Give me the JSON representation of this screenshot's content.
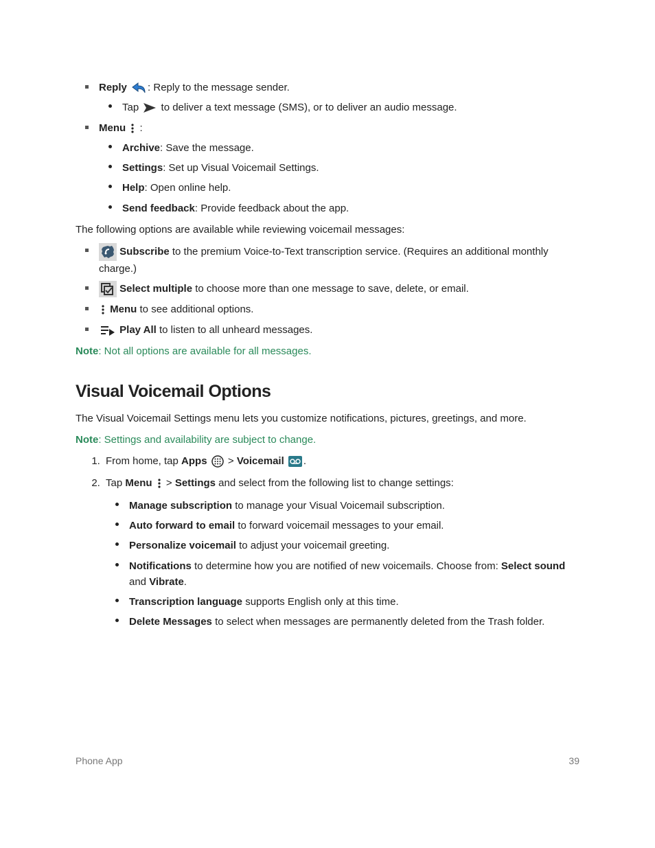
{
  "reply": {
    "label": "Reply",
    "desc": ": Reply to the message sender.",
    "tap": "Tap ",
    "tap_rest": " to deliver a text message (SMS), or to deliver an audio message."
  },
  "menu": {
    "label": "Menu",
    "suffix": " :",
    "items": {
      "archive": {
        "label": "Archive",
        "desc": ": Save the message."
      },
      "settings": {
        "label": "Settings",
        "desc": ": Set up Visual Voicemail Settings."
      },
      "help": {
        "label": "Help",
        "desc": ": Open online help."
      },
      "sendfb": {
        "label": "Send feedback",
        "desc": ": Provide feedback about the app."
      }
    }
  },
  "review_intro": "The following options are available while reviewing voicemail messages:",
  "review": {
    "subscribe": {
      "label": "Subscribe",
      "desc": " to the premium Voice-to-Text transcription service. (Requires an additional monthly charge.)"
    },
    "selectmult": {
      "label": "Select multiple",
      "desc": " to choose more than one message to save, delete, or email."
    },
    "menu2": {
      "label": "Menu",
      "desc": " to see additional options."
    },
    "playall": {
      "label": "Play All",
      "desc": " to listen to all unheard messages."
    }
  },
  "note1": {
    "label": "Note",
    "text": ": Not all options are available for all messages."
  },
  "section_title": "Visual Voicemail Options",
  "section_intro": "The Visual Voicemail Settings menu lets you customize notifications, pictures, greetings, and more.",
  "note2": {
    "label": "Note",
    "text": ": Settings and availability are subject to change."
  },
  "steps": {
    "s1": {
      "pre": "From home, tap ",
      "apps": "Apps",
      "mid": " > ",
      "vm": "Voicemail",
      "end": "."
    },
    "s2": {
      "pre": "Tap ",
      "menu": "Menu",
      "mid": "  > ",
      "settings": "Settings",
      "end": " and select from the following list to change settings:"
    }
  },
  "settings_list": {
    "i1": {
      "label": "Manage subscription",
      "desc": " to manage your Visual Voicemail subscription."
    },
    "i2": {
      "label": "Auto forward to email",
      "desc": " to forward voicemail messages to your email."
    },
    "i3": {
      "label": "Personalize voicemail",
      "desc": " to adjust your voicemail greeting."
    },
    "i4": {
      "label": "Notifications",
      "desc1": " to determine how you are notified of new voicemails. Choose from: ",
      "opt1": "Select sound",
      "and": " and ",
      "opt2": "Vibrate",
      "end": "."
    },
    "i5": {
      "label": "Transcription  language",
      "desc": " supports English only at this time."
    },
    "i6": {
      "label": "Delete Messages",
      "desc": " to select when messages are permanently deleted from the Trash folder."
    }
  },
  "footer": {
    "left": "Phone App",
    "right": "39"
  }
}
